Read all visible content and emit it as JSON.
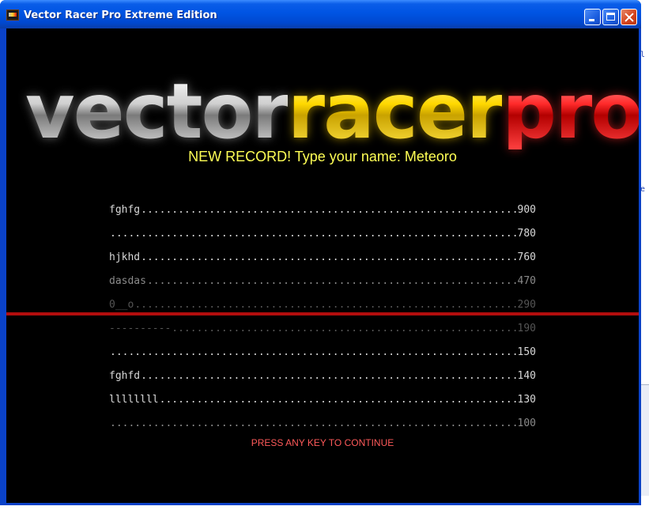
{
  "window": {
    "title": "Vector Racer Pro Extreme Edition"
  },
  "background": {
    "right_text_1": "l",
    "right_text_2": "e"
  },
  "logo": {
    "part1": "vector",
    "part2": "racer",
    "part3": "pro",
    "colors": {
      "part1": "#cfcfcf",
      "part2": "#ffd800",
      "part3": "#ff2a2a"
    }
  },
  "prompt": {
    "text": "NEW RECORD! Type your name: Meteoro",
    "color": "#ffff55"
  },
  "highscores": [
    {
      "name": "fghfg",
      "score": "900",
      "shade": "bright"
    },
    {
      "name": "",
      "score": "780",
      "shade": "bright"
    },
    {
      "name": "hjkhd",
      "score": "760",
      "shade": "bright"
    },
    {
      "name": "dasdas",
      "score": "470",
      "shade": "mid"
    },
    {
      "name": "0__o",
      "score": "290",
      "shade": "dim"
    },
    {
      "name": "----------",
      "score": "190",
      "shade": "dim"
    },
    {
      "name": "",
      "score": "150",
      "shade": "bright"
    },
    {
      "name": "fghfd",
      "score": "140",
      "shade": "bright"
    },
    {
      "name": "llllllll",
      "score": "130",
      "shade": "bright"
    },
    {
      "name": "",
      "score": "100",
      "shade": "mid"
    }
  ],
  "footer": {
    "continue_text": "PRESS ANY KEY TO CONTINUE",
    "color": "#ff5a5a"
  },
  "accent_colors": {
    "divider": "#b30d0d",
    "titlebar": "#0054e3"
  }
}
